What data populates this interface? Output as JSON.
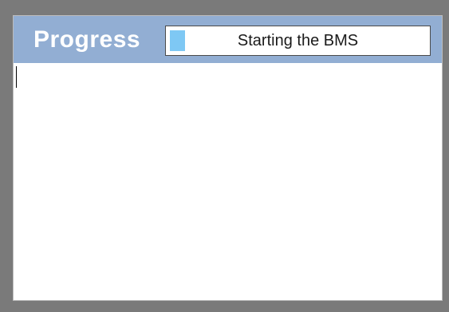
{
  "header": {
    "title": "Progress"
  },
  "progress": {
    "label": "Starting the BMS",
    "fraction": 0.06
  },
  "colors": {
    "header_background": "#92aed3",
    "progress_fill": "#7ec8f4",
    "outer_background": "#7a7a7a"
  }
}
